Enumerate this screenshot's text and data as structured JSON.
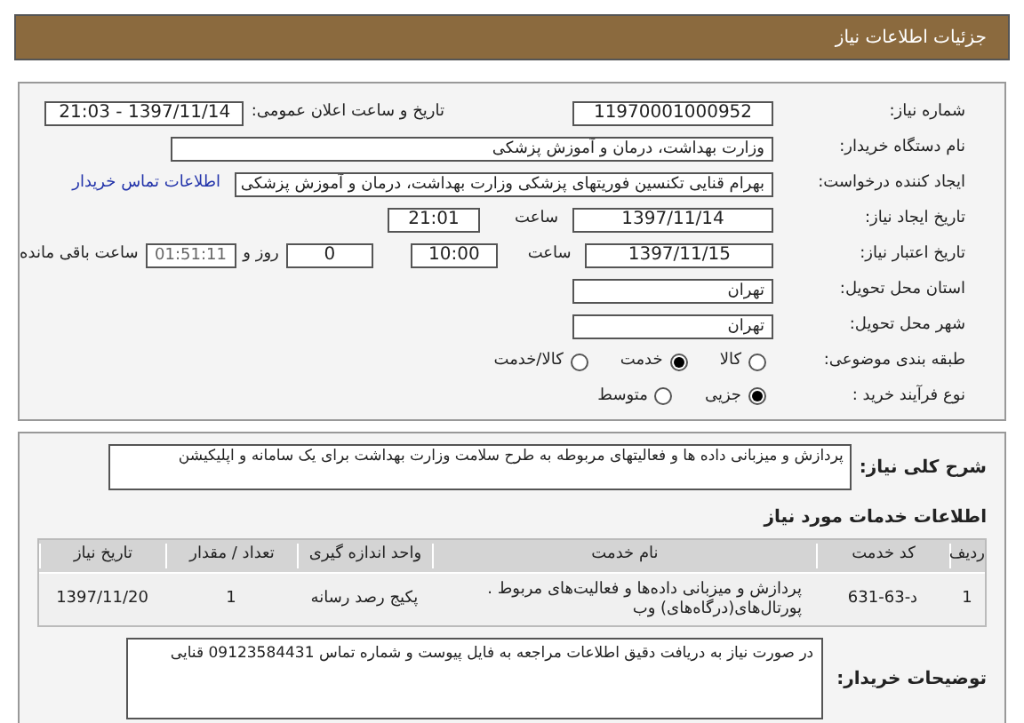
{
  "header": {
    "title": "جزئیات اطلاعات نیاز"
  },
  "need_number": {
    "label": "شماره نیاز:",
    "value": "11970001000952"
  },
  "announce": {
    "label": "تاریخ و ساعت اعلان عمومی:",
    "value": "1397/11/14 - 21:03"
  },
  "buyer": {
    "label": "نام دستگاه خریدار:",
    "value": "وزارت بهداشت، درمان و آموزش پزشکی"
  },
  "requester": {
    "label": "ایجاد کننده درخواست:",
    "value": "بهرام قنایی تکنسین فوریتهای پزشکی وزارت بهداشت، درمان و آموزش پزشکی",
    "link": "اطلاعات تماس خریدار"
  },
  "created": {
    "label": "تاریخ ایجاد نیاز:",
    "date": "1397/11/14",
    "time_label": "ساعت",
    "time": "21:01"
  },
  "validity": {
    "label": "تاریخ اعتبار نیاز:",
    "date": "1397/11/15",
    "time_label": "ساعت",
    "time": "10:00",
    "days": "0",
    "days_label": "روز و",
    "remaining": "01:51:11",
    "remaining_label": "ساعت باقی مانده"
  },
  "province": {
    "label": "استان محل تحویل:",
    "value": "تهران"
  },
  "city": {
    "label": "شهر محل تحویل:",
    "value": "تهران"
  },
  "category": {
    "label": "طبقه بندی موضوعی:",
    "options": [
      {
        "label": "کالا",
        "selected": false
      },
      {
        "label": "خدمت",
        "selected": true
      },
      {
        "label": "کالا/خدمت",
        "selected": false
      }
    ]
  },
  "process": {
    "label": "نوع فرآیند خرید :",
    "options": [
      {
        "label": "جزیی",
        "selected": true
      },
      {
        "label": "متوسط",
        "selected": false
      }
    ]
  },
  "summary": {
    "label": "شرح کلی نیاز:",
    "value": "پردازش و میزبانی داده ها و فعالیتهای مربوطه به طرح سلامت وزارت بهداشت برای یک سامانه و اپلیکیشن"
  },
  "services_heading": "اطلاعات خدمات مورد نیاز",
  "table": {
    "columns": [
      "ردیف",
      "کد خدمت",
      "نام خدمت",
      "واحد اندازه گیری",
      "تعداد / مقدار",
      "تاریخ نیاز"
    ],
    "rows": [
      [
        "1",
        "د-63-631",
        "پردازش و میزبانی داده‌ها و فعالیت‌های مربوط . پورتال‌های(درگاه‌های) وب",
        "پکیج رصد رسانه",
        "1",
        "1397/11/20"
      ]
    ]
  },
  "notes": {
    "label": "توضیحات خریدار:",
    "value": "در صورت نیاز به دریافت دقیق اطلاعات مراجعه به فایل پیوست و شماره تماس 09123584431 قنایی"
  }
}
